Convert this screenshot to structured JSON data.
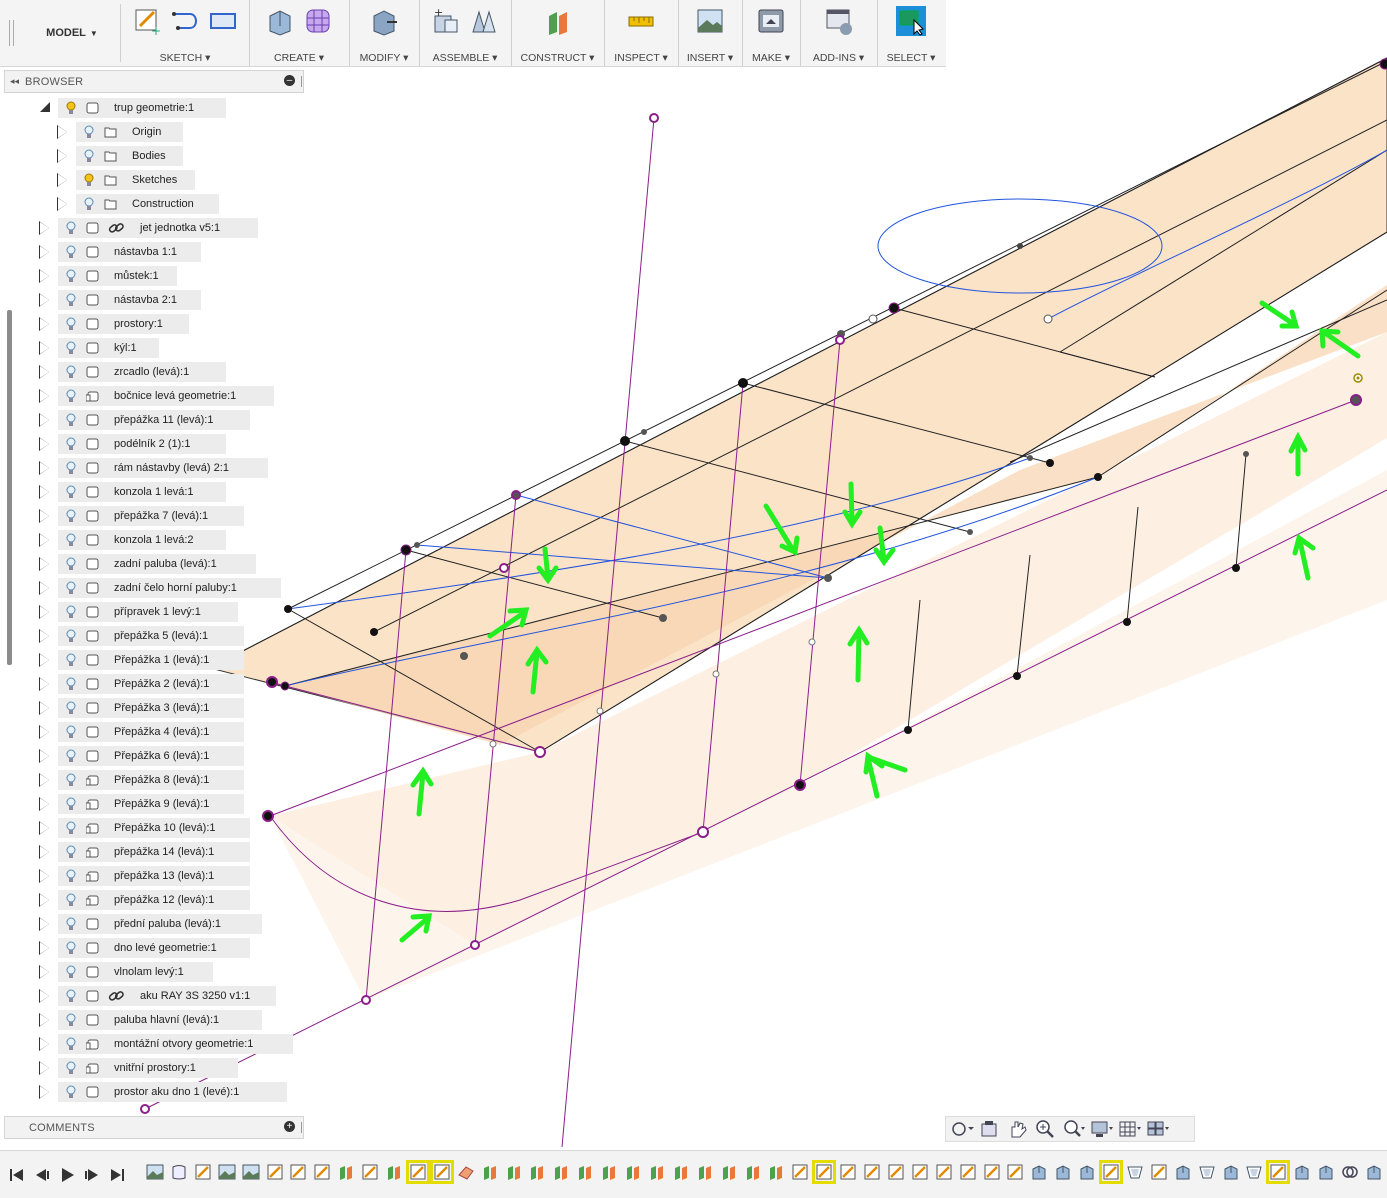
{
  "toolbar": {
    "workspace": "MODEL",
    "groups": [
      {
        "label": "SKETCH",
        "icons": [
          "sketch-create-icon",
          "spline-icon",
          "rectangle-icon"
        ]
      },
      {
        "label": "CREATE",
        "icons": [
          "extrude-icon",
          "form-icon"
        ]
      },
      {
        "label": "MODIFY",
        "icons": [
          "press-pull-icon"
        ]
      },
      {
        "label": "ASSEMBLE",
        "icons": [
          "new-component-icon",
          "joint-icon"
        ]
      },
      {
        "label": "CONSTRUCT",
        "icons": [
          "offset-plane-icon"
        ]
      },
      {
        "label": "INSPECT",
        "icons": [
          "measure-icon"
        ]
      },
      {
        "label": "INSERT",
        "icons": [
          "insert-image-icon"
        ]
      },
      {
        "label": "MAKE",
        "icons": [
          "3d-print-icon"
        ]
      },
      {
        "label": "ADD-INS",
        "icons": [
          "scripts-icon"
        ]
      },
      {
        "label": "SELECT",
        "icons": [
          "select-icon"
        ]
      }
    ]
  },
  "browser": {
    "title": "BROWSER",
    "items": [
      {
        "name": "trup geometrie:1",
        "level": 0,
        "expanded": true,
        "type": "component",
        "bulb": "on"
      },
      {
        "name": "Origin",
        "level": 1,
        "type": "folder",
        "bulb": "off"
      },
      {
        "name": "Bodies",
        "level": 1,
        "type": "folder",
        "bulb": "off"
      },
      {
        "name": "Sketches",
        "level": 1,
        "type": "folder",
        "bulb": "on"
      },
      {
        "name": "Construction",
        "level": 1,
        "type": "folder",
        "bulb": "off"
      },
      {
        "name": "jet jednotka v5:1",
        "level": 0,
        "type": "linked",
        "bulb": "off"
      },
      {
        "name": "nástavba 1:1",
        "level": 0,
        "type": "component",
        "bulb": "off"
      },
      {
        "name": "můstek:1",
        "level": 0,
        "type": "component",
        "bulb": "off"
      },
      {
        "name": "nástavba 2:1",
        "level": 0,
        "type": "component",
        "bulb": "off"
      },
      {
        "name": "prostory:1",
        "level": 0,
        "type": "component",
        "bulb": "off"
      },
      {
        "name": "kýl:1",
        "level": 0,
        "type": "component",
        "bulb": "off"
      },
      {
        "name": "zrcadlo (levá):1",
        "level": 0,
        "type": "component",
        "bulb": "off"
      },
      {
        "name": "bočnice levá geometrie:1",
        "level": 0,
        "type": "component-ref",
        "bulb": "off"
      },
      {
        "name": "přepážka 11 (levá):1",
        "level": 0,
        "type": "component",
        "bulb": "off"
      },
      {
        "name": "podélník 2 (1):1",
        "level": 0,
        "type": "component",
        "bulb": "off"
      },
      {
        "name": "rám nástavby (levá) 2:1",
        "level": 0,
        "type": "component",
        "bulb": "off"
      },
      {
        "name": "konzola 1 levá:1",
        "level": 0,
        "type": "component",
        "bulb": "off"
      },
      {
        "name": "přepážka 7 (levá):1",
        "level": 0,
        "type": "component",
        "bulb": "off"
      },
      {
        "name": "konzola 1 levá:2",
        "level": 0,
        "type": "component",
        "bulb": "off"
      },
      {
        "name": "zadní paluba (levá):1",
        "level": 0,
        "type": "component",
        "bulb": "off"
      },
      {
        "name": "zadní čelo horní paluby:1",
        "level": 0,
        "type": "component",
        "bulb": "off"
      },
      {
        "name": "přípravek 1 levý:1",
        "level": 0,
        "type": "component",
        "bulb": "off"
      },
      {
        "name": "přepážka 5 (levá):1",
        "level": 0,
        "type": "component",
        "bulb": "off"
      },
      {
        "name": "Přepážka 1 (levá):1",
        "level": 0,
        "type": "component",
        "bulb": "off"
      },
      {
        "name": "Přepážka 2 (levá):1",
        "level": 0,
        "type": "component",
        "bulb": "off"
      },
      {
        "name": "Přepážka 3 (levá):1",
        "level": 0,
        "type": "component",
        "bulb": "off"
      },
      {
        "name": "Přepážka 4 (levá):1",
        "level": 0,
        "type": "component",
        "bulb": "off"
      },
      {
        "name": "Přepážka 6 (levá):1",
        "level": 0,
        "type": "component",
        "bulb": "off"
      },
      {
        "name": "Přepážka 8 (levá):1",
        "level": 0,
        "type": "component-ref",
        "bulb": "off"
      },
      {
        "name": "Přepážka 9 (levá):1",
        "level": 0,
        "type": "component-ref",
        "bulb": "off"
      },
      {
        "name": "Přepážka 10 (levá):1",
        "level": 0,
        "type": "component-ref",
        "bulb": "off"
      },
      {
        "name": "přepážka 14 (levá):1",
        "level": 0,
        "type": "component-ref",
        "bulb": "off"
      },
      {
        "name": "přepážka 13 (levá):1",
        "level": 0,
        "type": "component-ref",
        "bulb": "off"
      },
      {
        "name": "přepážka 12 (levá):1",
        "level": 0,
        "type": "component-ref",
        "bulb": "off"
      },
      {
        "name": "přední paluba (levá):1",
        "level": 0,
        "type": "component",
        "bulb": "off"
      },
      {
        "name": "dno levé geometrie:1",
        "level": 0,
        "type": "component",
        "bulb": "off"
      },
      {
        "name": "vlnolam levý:1",
        "level": 0,
        "type": "component",
        "bulb": "off"
      },
      {
        "name": "aku RAY 3S 3250 v1:1",
        "level": 0,
        "type": "linked",
        "bulb": "off"
      },
      {
        "name": "paluba hlavní (levá):1",
        "level": 0,
        "type": "component",
        "bulb": "off"
      },
      {
        "name": "montážní otvory geometrie:1",
        "level": 0,
        "type": "component-ref",
        "bulb": "off"
      },
      {
        "name": "vnitřní prostory:1",
        "level": 0,
        "type": "component-ref",
        "bulb": "off"
      },
      {
        "name": "prostor aku dno 1 (levé):1",
        "level": 0,
        "type": "component",
        "bulb": "off"
      }
    ]
  },
  "comments": {
    "title": "COMMENTS"
  },
  "navbar": {
    "buttons": [
      "orbit-icon",
      "look-at-icon",
      "pan-icon",
      "zoom-window-icon",
      "zoom-icon",
      "display-settings-icon",
      "grid-settings-icon",
      "viewports-icon"
    ]
  },
  "timeline": {
    "controls": [
      "rewind-to-start-icon",
      "step-back-icon",
      "play-icon",
      "step-forward-icon",
      "skip-to-end-icon"
    ],
    "features": [
      "image",
      "plane",
      "sketch",
      "image",
      "image",
      "sketch",
      "sketch",
      "sketch",
      "offset",
      "sketch",
      "offset",
      "sketch-hl",
      "sketch-hl",
      "loft",
      "offset",
      "offset",
      "offset",
      "offset",
      "offset",
      "offset",
      "offset",
      "offset",
      "offset",
      "offset",
      "offset",
      "offset",
      "offset",
      "sketch",
      "sketch-hl",
      "sketch",
      "sketch",
      "sketch",
      "sketch",
      "sketch",
      "sketch",
      "sketch",
      "sketch",
      "extrude",
      "extrude",
      "extrude",
      "sketch-hl",
      "shell",
      "sketch",
      "extrude",
      "shell",
      "extrude",
      "shell",
      "sketch-hl",
      "extrude",
      "extrude",
      "combine",
      "extrude"
    ],
    "highlight_color": "#e4dc00"
  },
  "colors": {
    "accent": "#1c8fd8",
    "surface": "#fbe0c3",
    "construction": "#8a1e8a",
    "sketch_line": "#2255dd",
    "annotation_arrows": "#22ee22"
  }
}
